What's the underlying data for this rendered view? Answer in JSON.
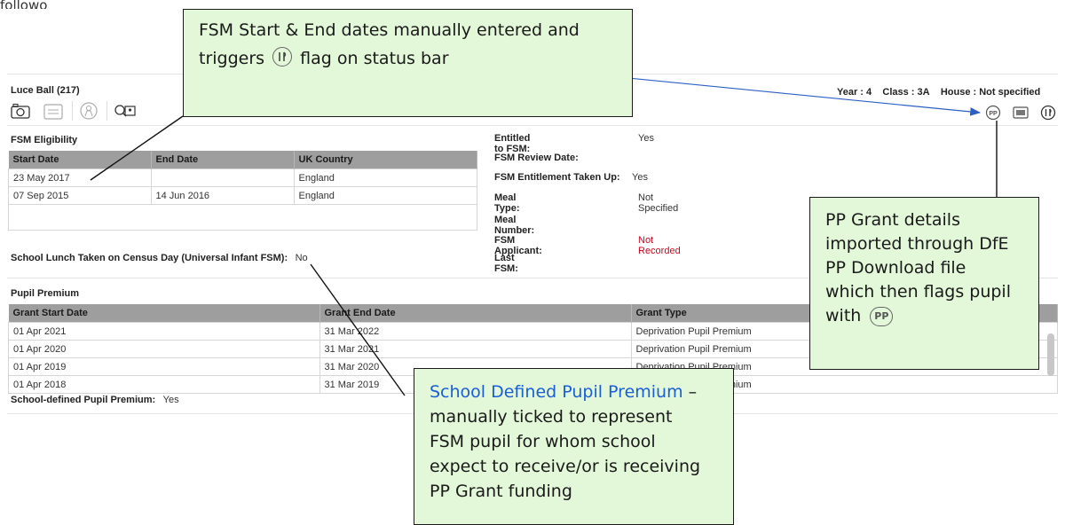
{
  "top_text": "followo",
  "pupil": {
    "name": "Luce Ball (217)",
    "year": "Year : 4",
    "class": "Class : 3A",
    "house": "House : Not specified"
  },
  "toolbar_icons": [
    "camera-icon",
    "notes-icon",
    "person-icon",
    "contact-card-icon"
  ],
  "status_icons": {
    "pp": "PP",
    "fsm": "🍴"
  },
  "fsm_eligibility": {
    "title": "FSM Eligibility",
    "columns": [
      "Start Date",
      "End Date",
      "UK Country"
    ],
    "rows": [
      [
        "23 May 2017",
        "",
        "England"
      ],
      [
        "07 Sep 2015",
        "14 Jun 2016",
        "England"
      ]
    ]
  },
  "school_lunch": {
    "label": "School Lunch Taken on Census Day (Universal Infant FSM):",
    "value": "No"
  },
  "fsm_details": [
    {
      "label": "Entitled to FSM:",
      "value": "Yes"
    },
    {
      "label": "FSM Review Date:",
      "value": ""
    },
    {
      "label": "FSM Entitlement Taken Up:",
      "value": "Yes"
    },
    {
      "label": "Meal Type:",
      "value": "Not Specified"
    },
    {
      "label": "Meal Number:",
      "value": ""
    },
    {
      "label": "FSM Applicant:",
      "value": "Not Recorded"
    },
    {
      "label": "Last FSM:",
      "value": ""
    }
  ],
  "pupil_premium": {
    "title": "Pupil Premium",
    "columns": [
      "Grant Start Date",
      "Grant End Date",
      "Grant Type"
    ],
    "rows": [
      [
        "01 Apr 2021",
        "31 Mar 2022",
        "Deprivation Pupil Premium"
      ],
      [
        "01 Apr 2020",
        "31 Mar 2021",
        "Deprivation Pupil Premium"
      ],
      [
        "01 Apr 2019",
        "31 Mar 2020",
        "Deprivation Pupil Premium"
      ],
      [
        "01 Apr 2018",
        "31 Mar 2019",
        "Deprivation Pupil Premium"
      ]
    ]
  },
  "school_defined_pp": {
    "label": "School-defined Pupil Premium:",
    "value": "Yes"
  },
  "callouts": {
    "fsm_dates": {
      "line1": "FSM Start & End dates manually entered and",
      "line2_pre": "triggers",
      "line2_post": "flag on status bar"
    },
    "pp_grant": {
      "lines": [
        "PP Grant details",
        "imported through DfE",
        "PP Download file",
        "which then flags pupil"
      ],
      "with_text": "with",
      "icon_text": "PP"
    },
    "school_defined": {
      "title": "School Defined Pupil Premium",
      "dash": " –",
      "lines": [
        "manually ticked to represent",
        "FSM pupil for whom school",
        "expect to receive/or is receiving",
        "PP Grant funding"
      ]
    }
  },
  "colors": {
    "callout_bg": "#e3f7d9",
    "header_bg": "#9e9e9e",
    "not_recorded": "#d0021b",
    "callout_title": "#1a5fd6",
    "arrow": "#2b5fc4"
  }
}
